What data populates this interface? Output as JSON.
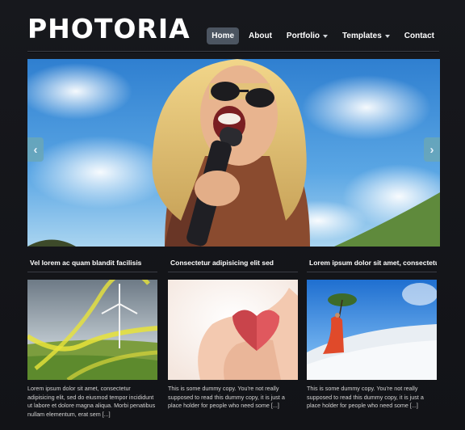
{
  "brand": {
    "logo_text": "PHOTORIA"
  },
  "nav": {
    "items": [
      {
        "label": "Home",
        "active": true,
        "dropdown": false
      },
      {
        "label": "About",
        "active": false,
        "dropdown": false
      },
      {
        "label": "Portfolio",
        "active": false,
        "dropdown": true
      },
      {
        "label": "Templates",
        "active": false,
        "dropdown": true
      },
      {
        "label": "Contact",
        "active": false,
        "dropdown": false
      }
    ]
  },
  "slider": {
    "prev_icon": "chevron-left-icon",
    "prev_glyph": "‹",
    "next_icon": "chevron-right-icon",
    "next_glyph": "›"
  },
  "features": [
    {
      "title": "Vel lorem ac quam blandit facilisis",
      "text": "Lorem ipsum dolor sit amet, consectetur adipisicing elit, sed do eiusmod tempor incididunt ut labore et dolore magna aliqua. Morbi penatibus nullam elementum, erat sem [...]"
    },
    {
      "title": "Consectetur adipisicing elit sed",
      "text": "This is some dummy copy. You're not really supposed to read this dummy copy, it is just a place holder for people who need some [...]"
    },
    {
      "title": "Lorem ipsum dolor sit amet, consectetuer",
      "text": "This is some dummy copy. You're not really supposed to read this dummy copy, it is just a place holder for people who need some [...]"
    }
  ],
  "colors": {
    "background": "#15161b",
    "nav_active": "#4c5561",
    "slider_arrow": "#6aa7b8"
  }
}
